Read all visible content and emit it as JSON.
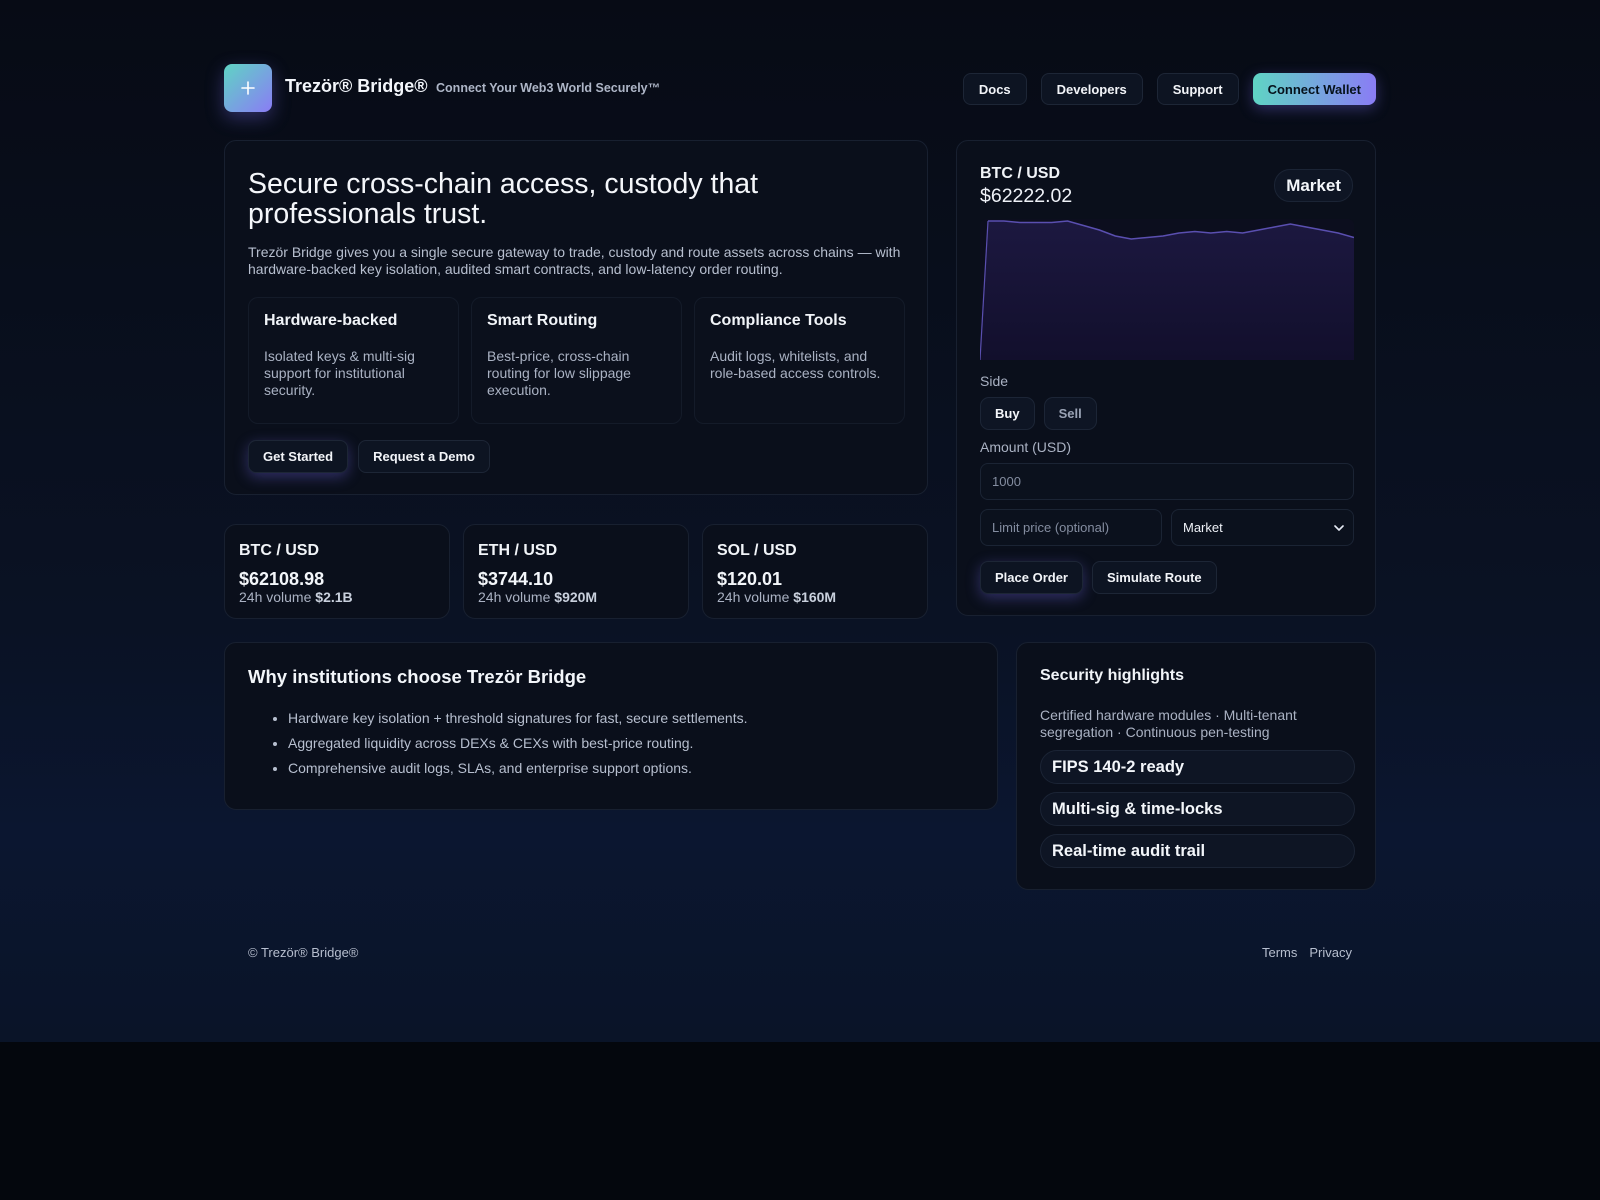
{
  "header": {
    "logo_icon": "plus-icon",
    "brand_name": "Trezör® Bridge®",
    "brand_tagline": "Connect Your Web3 World Securely™",
    "nav": [
      "Docs",
      "Developers",
      "Support"
    ],
    "connect_label": "Connect Wallet"
  },
  "hero": {
    "title": "Secure cross-chain access, custody that professionals trust.",
    "description": "Trezör Bridge gives you a single secure gateway to trade, custody and route assets across chains — with hardware-backed key isolation, audited smart contracts, and low-latency order routing.",
    "features": [
      {
        "title": "Hardware-backed",
        "desc": "Isolated keys & multi-sig support for institutional security."
      },
      {
        "title": "Smart Routing",
        "desc": "Best-price, cross-chain routing for low slippage execution."
      },
      {
        "title": "Compliance Tools",
        "desc": "Audit logs, whitelists, and role-based access controls."
      }
    ],
    "primary_cta": "Get Started",
    "secondary_cta": "Request a Demo"
  },
  "trade": {
    "pair": "BTC / USD",
    "price": "$62222.02",
    "mode": "Market",
    "side_label": "Side",
    "buy_label": "Buy",
    "sell_label": "Sell",
    "amount_label": "Amount (USD)",
    "amount_placeholder": "1000",
    "limit_placeholder": "Limit price (optional)",
    "order_type": "Market",
    "place_order": "Place Order",
    "simulate_route": "Simulate Route",
    "chart_color": "#5a4fb0"
  },
  "chart_data": {
    "type": "area",
    "title": "",
    "xlabel": "",
    "ylabel": "",
    "values": [
      62222,
      62222,
      62221,
      62221,
      62221,
      62222,
      62219,
      62216,
      62212,
      62210,
      62211,
      62212,
      62214,
      62215,
      62214,
      62215,
      62214,
      62216,
      62218,
      62220,
      62218,
      62216,
      62214,
      62211
    ]
  },
  "tickers": [
    {
      "pair": "BTC / USD",
      "price": "$62108.98",
      "vol_label": "24h volume",
      "vol": "$2.1B"
    },
    {
      "pair": "ETH / USD",
      "price": "$3744.10",
      "vol_label": "24h volume",
      "vol": "$920M"
    },
    {
      "pair": "SOL / USD",
      "price": "$120.01",
      "vol_label": "24h volume",
      "vol": "$160M"
    }
  ],
  "why": {
    "title": "Why institutions choose Trezör Bridge",
    "items": [
      "Hardware key isolation + threshold signatures for fast, secure settlements.",
      "Aggregated liquidity across DEXs & CEXs with best-price routing.",
      "Comprehensive audit logs, SLAs, and enterprise support options."
    ]
  },
  "security": {
    "title": "Security highlights",
    "desc": "Certified hardware modules · Multi-tenant segregation · Continuous pen-testing",
    "pills": [
      "FIPS 140-2 ready",
      "Multi-sig & time-locks",
      "Real-time audit trail"
    ]
  },
  "footer": {
    "copyright": "© Trezör® Bridge®",
    "links": [
      "Terms",
      "Privacy"
    ]
  },
  "colors": {
    "accent_start": "#5fd4c4",
    "accent_end": "#8a7cf5",
    "background": "#070b15"
  }
}
